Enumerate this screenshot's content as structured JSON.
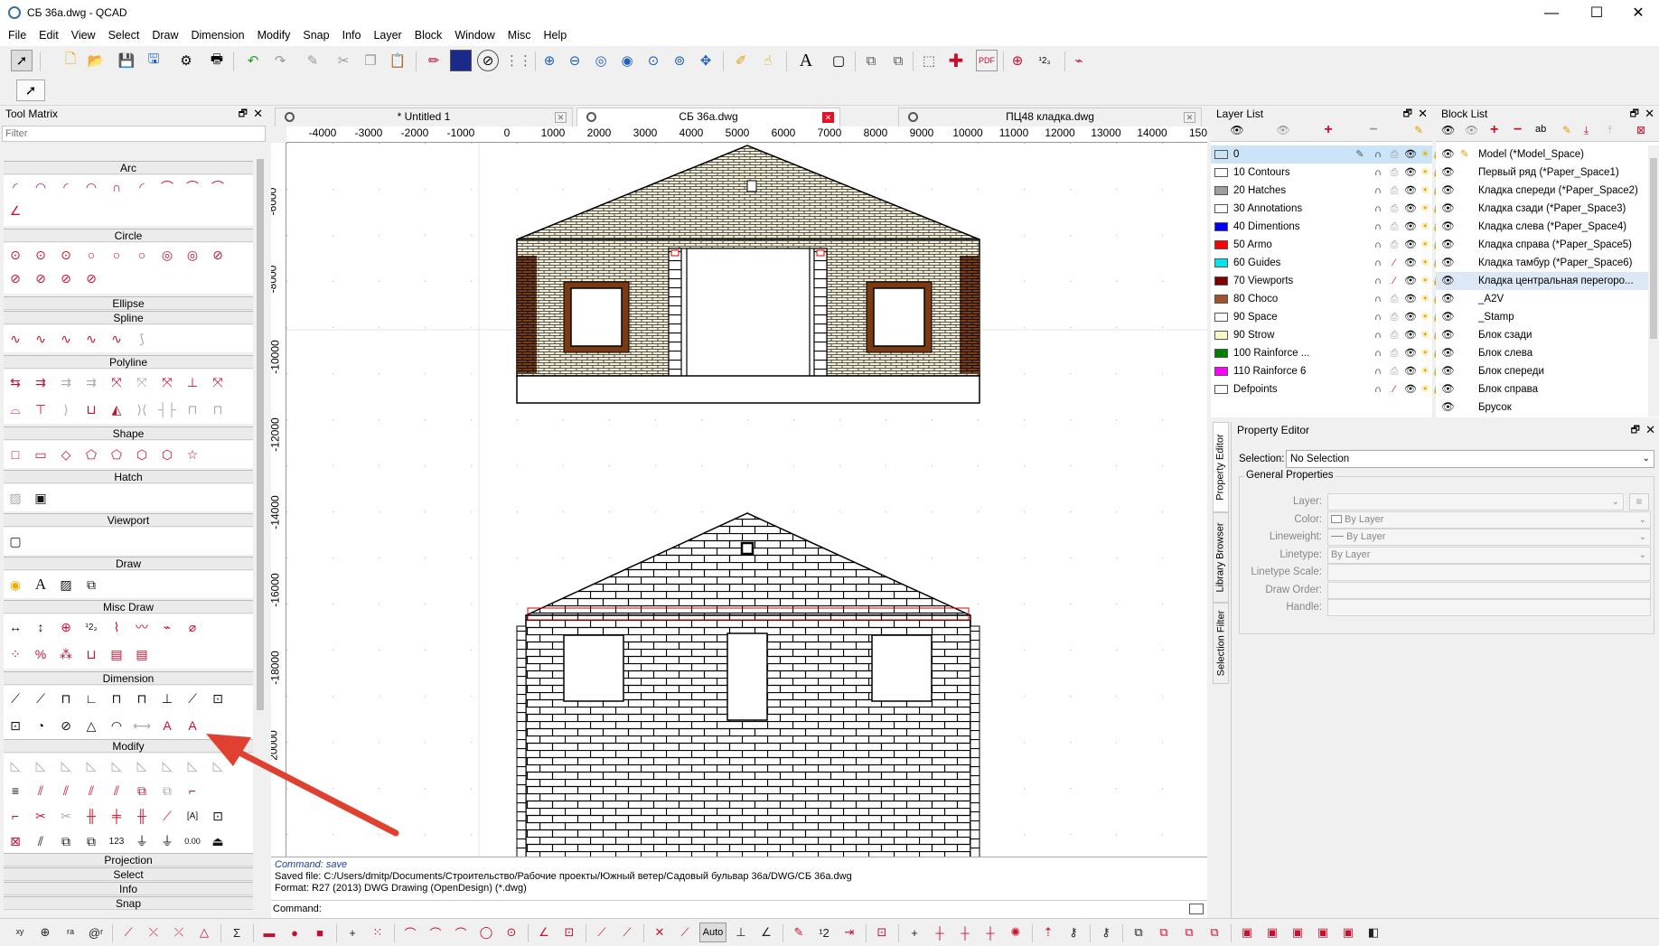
{
  "window": {
    "title": "СБ 36а.dwg - QCAD",
    "minimize": "—",
    "maximize": "☐",
    "close": "✕"
  },
  "menu": [
    "File",
    "Edit",
    "View",
    "Select",
    "Draw",
    "Dimension",
    "Modify",
    "Snap",
    "Info",
    "Layer",
    "Block",
    "Window",
    "Misc",
    "Help"
  ],
  "tool_matrix": {
    "title": "Tool Matrix",
    "filter_placeholder": "Filter",
    "sections": [
      "Arc",
      "Circle",
      "Ellipse",
      "Spline",
      "Polyline",
      "Shape",
      "Hatch",
      "Viewport",
      "Draw",
      "Misc Draw",
      "Dimension",
      "Modify",
      "Projection",
      "Select",
      "Info",
      "Snap"
    ],
    "misc_labels": {
      "num": "¹2₃",
      "num2": "123",
      "dim": "0.00"
    }
  },
  "tabs": [
    {
      "label": "* Untitled 1",
      "active": false
    },
    {
      "label": "СБ 36а.dwg",
      "active": true
    },
    {
      "label": "ПЦ48 кладка.dwg",
      "active": false
    }
  ],
  "ruler": {
    "h_ticks": [
      "00",
      "-4000",
      "-3000",
      "-2000",
      "-1000",
      "0",
      "1000",
      "2000",
      "3000",
      "4000",
      "5000",
      "6000",
      "7000",
      "8000",
      "9000",
      "10000",
      "11000",
      "12000",
      "13000",
      "14000",
      "150"
    ],
    "v_ticks": [
      "-6000",
      "-8000",
      "-10000",
      "-12000",
      "-14000",
      "-16000",
      "-18000",
      "20000"
    ]
  },
  "command": {
    "log_cmd": "Command: save",
    "log_saved": "Saved file: C:/Users/dmitp/Documents/Строительство/Рабочие проекты/Южный ветер/Садовый бульвар 36а/DWG/СБ 36а.dwg",
    "log_format": "Format: R27 (2013) DWG Drawing (OpenDesign) (*.dwg)",
    "prompt": "Command:"
  },
  "layer_list": {
    "title": "Layer List",
    "layers": [
      {
        "name": "0",
        "color": "#c9e3f5"
      },
      {
        "name": "10 Contours",
        "color": "#ffffff"
      },
      {
        "name": "20 Hatches",
        "color": "#9e9e9e"
      },
      {
        "name": "30 Annotations",
        "color": "#ffffff"
      },
      {
        "name": "40 Dimentions",
        "color": "#0000ff"
      },
      {
        "name": "50 Armo",
        "color": "#ff0000"
      },
      {
        "name": "60 Guides",
        "color": "#00e5ee"
      },
      {
        "name": "70 Viewports",
        "color": "#7f0000"
      },
      {
        "name": "80 Choco",
        "color": "#a0522d"
      },
      {
        "name": "90 Space",
        "color": "#ffffff"
      },
      {
        "name": "90 Strow",
        "color": "#fff8c0"
      },
      {
        "name": "100 Rainforce ...",
        "color": "#008000"
      },
      {
        "name": "110 Rainforce 6",
        "color": "#ff00ff"
      },
      {
        "name": "Defpoints",
        "color": "#ffffff"
      }
    ]
  },
  "block_list": {
    "title": "Block List",
    "toolbar_ab": "ab",
    "blocks": [
      "Model (*Model_Space)",
      "Первый ряд (*Paper_Space1)",
      "Кладка спереди (*Paper_Space2)",
      "Кладка сзади (*Paper_Space3)",
      "Кладка слева (*Paper_Space4)",
      "Кладка справа (*Paper_Space5)",
      "Кладка тамбур (*Paper_Space6)",
      "Кладка центральная перегоро...",
      "_A2V",
      "_Stamp",
      "Блок сзади",
      "Блок слева",
      "Блок спереди",
      "Блок справа",
      "Брусок"
    ]
  },
  "property_editor": {
    "title": "Property Editor",
    "selection_label": "Selection:",
    "selection_value": "No Selection",
    "group_title": "General Properties",
    "fields": [
      {
        "label": "Layer:",
        "value": ""
      },
      {
        "label": "Color:",
        "value": "By Layer"
      },
      {
        "label": "Lineweight:",
        "value": "By Layer"
      },
      {
        "label": "Linetype:",
        "value": "By Layer"
      },
      {
        "label": "Linetype Scale:",
        "value": ""
      },
      {
        "label": "Draw Order:",
        "value": ""
      },
      {
        "label": "Handle:",
        "value": ""
      }
    ],
    "side_tabs": [
      "Property Editor",
      "Library Browser",
      "Selection Filter"
    ]
  },
  "status_bar": {
    "auto_label": "Auto"
  },
  "colors": {
    "brick_light": "#f5f0d7",
    "brick_dark": "#7a3a12",
    "accent_red": "#c8102e",
    "annotation_arrow": "#e0402f"
  }
}
